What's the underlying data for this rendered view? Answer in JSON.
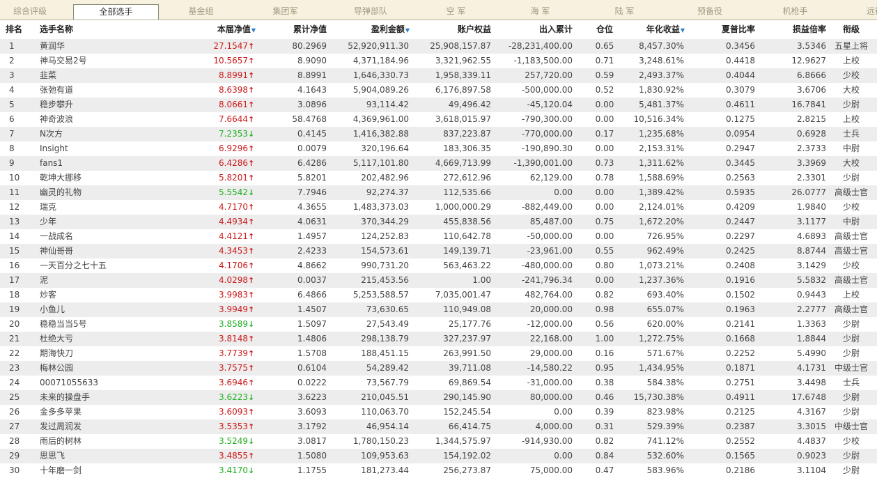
{
  "tabs": [
    {
      "label": "综合评级",
      "active": false
    },
    {
      "label": "全部选手",
      "active": true
    },
    {
      "label": "基金组",
      "active": false
    },
    {
      "label": "集团军",
      "active": false
    },
    {
      "label": "导弹部队",
      "active": false
    },
    {
      "label": "空  军",
      "active": false
    },
    {
      "label": "海  军",
      "active": false
    },
    {
      "label": "陆  军",
      "active": false
    },
    {
      "label": "预备役",
      "active": false
    },
    {
      "label": "机枪手",
      "active": false
    },
    {
      "label": "远征",
      "active": false
    }
  ],
  "columns": {
    "rank": "排名",
    "name": "选手名称",
    "nav": "本届净值",
    "cum_nav": "累计净值",
    "profit": "盈利金额",
    "equity": "账户权益",
    "flow": "出入累计",
    "position": "仓位",
    "annual": "年化收益",
    "sharpe": "夏普比率",
    "pl_ratio": "损益倍率",
    "title": "衔级"
  },
  "sort_icon": "triangle-down-icon",
  "colors": {
    "up": "#cc1a1a",
    "down": "#1fae1f",
    "sort": "#2a7fd0",
    "row_alt": "#ededed",
    "tabbar": "#f7f1df"
  },
  "rows": [
    {
      "rank": "1",
      "name": "黄润华",
      "nav": "27.1547",
      "trend": "up",
      "cum_nav": "80.2969",
      "profit": "52,920,911.30",
      "equity": "25,908,157.87",
      "flow": "-28,231,400.00",
      "position": "0.65",
      "annual": "8,457.30%",
      "sharpe": "0.3456",
      "pl_ratio": "3.5346",
      "title": "五星上将"
    },
    {
      "rank": "2",
      "name": "神马交易2号",
      "nav": "10.5657",
      "trend": "up",
      "cum_nav": "8.9090",
      "profit": "4,371,184.96",
      "equity": "3,321,962.55",
      "flow": "-1,183,500.00",
      "position": "0.71",
      "annual": "3,248.61%",
      "sharpe": "0.4418",
      "pl_ratio": "12.9627",
      "title": "上校"
    },
    {
      "rank": "3",
      "name": "韭菜",
      "nav": "8.8991",
      "trend": "up",
      "cum_nav": "8.8991",
      "profit": "1,646,330.73",
      "equity": "1,958,339.11",
      "flow": "257,720.00",
      "position": "0.59",
      "annual": "2,493.37%",
      "sharpe": "0.4044",
      "pl_ratio": "6.8666",
      "title": "少校"
    },
    {
      "rank": "4",
      "name": "张弛有道",
      "nav": "8.6398",
      "trend": "up",
      "cum_nav": "4.1643",
      "profit": "5,904,089.26",
      "equity": "6,176,897.58",
      "flow": "-500,000.00",
      "position": "0.52",
      "annual": "1,830.92%",
      "sharpe": "0.3079",
      "pl_ratio": "3.6706",
      "title": "大校"
    },
    {
      "rank": "5",
      "name": "稳步攀升",
      "nav": "8.0661",
      "trend": "up",
      "cum_nav": "3.0896",
      "profit": "93,114.42",
      "equity": "49,496.42",
      "flow": "-45,120.04",
      "position": "0.00",
      "annual": "5,481.37%",
      "sharpe": "0.4611",
      "pl_ratio": "16.7841",
      "title": "少尉"
    },
    {
      "rank": "6",
      "name": "神奇波浪",
      "nav": "7.6644",
      "trend": "up",
      "cum_nav": "58.4768",
      "profit": "4,369,961.00",
      "equity": "3,618,015.97",
      "flow": "-790,300.00",
      "position": "0.00",
      "annual": "10,516.34%",
      "sharpe": "0.1275",
      "pl_ratio": "2.8215",
      "title": "上校"
    },
    {
      "rank": "7",
      "name": "N次方",
      "nav": "7.2353",
      "trend": "down",
      "cum_nav": "0.4145",
      "profit": "1,416,382.88",
      "equity": "837,223.87",
      "flow": "-770,000.00",
      "position": "0.17",
      "annual": "1,235.68%",
      "sharpe": "0.0954",
      "pl_ratio": "0.6928",
      "title": "士兵"
    },
    {
      "rank": "8",
      "name": "Insight",
      "nav": "6.9296",
      "trend": "up",
      "cum_nav": "0.0079",
      "profit": "320,196.64",
      "equity": "183,306.35",
      "flow": "-190,890.30",
      "position": "0.00",
      "annual": "2,153.31%",
      "sharpe": "0.2947",
      "pl_ratio": "2.3733",
      "title": "中尉"
    },
    {
      "rank": "9",
      "name": "fans1",
      "nav": "6.4286",
      "trend": "up",
      "cum_nav": "6.4286",
      "profit": "5,117,101.80",
      "equity": "4,669,713.99",
      "flow": "-1,390,001.00",
      "position": "0.73",
      "annual": "1,311.62%",
      "sharpe": "0.3445",
      "pl_ratio": "3.3969",
      "title": "大校"
    },
    {
      "rank": "10",
      "name": "乾坤大挪移",
      "nav": "5.8201",
      "trend": "up",
      "cum_nav": "5.8201",
      "profit": "202,482.96",
      "equity": "272,612.96",
      "flow": "62,129.00",
      "position": "0.78",
      "annual": "1,588.69%",
      "sharpe": "0.2563",
      "pl_ratio": "2.3301",
      "title": "少尉"
    },
    {
      "rank": "11",
      "name": "幽灵的礼物",
      "nav": "5.5542",
      "trend": "down",
      "cum_nav": "7.7946",
      "profit": "92,274.37",
      "equity": "112,535.66",
      "flow": "0.00",
      "position": "0.00",
      "annual": "1,389.42%",
      "sharpe": "0.5935",
      "pl_ratio": "26.0777",
      "title": "高级士官"
    },
    {
      "rank": "12",
      "name": "瑞克",
      "nav": "4.7170",
      "trend": "up",
      "cum_nav": "4.3655",
      "profit": "1,483,373.03",
      "equity": "1,000,000.29",
      "flow": "-882,449.00",
      "position": "0.00",
      "annual": "2,124.01%",
      "sharpe": "0.4209",
      "pl_ratio": "1.9840",
      "title": "少校"
    },
    {
      "rank": "13",
      "name": "少年",
      "nav": "4.4934",
      "trend": "up",
      "cum_nav": "4.0631",
      "profit": "370,344.29",
      "equity": "455,838.56",
      "flow": "85,487.00",
      "position": "0.75",
      "annual": "1,672.20%",
      "sharpe": "0.2447",
      "pl_ratio": "3.1177",
      "title": "中尉"
    },
    {
      "rank": "14",
      "name": "一战成名",
      "nav": "4.4121",
      "trend": "up",
      "cum_nav": "1.4957",
      "profit": "124,252.83",
      "equity": "110,642.78",
      "flow": "-50,000.00",
      "position": "0.00",
      "annual": "726.95%",
      "sharpe": "0.2297",
      "pl_ratio": "4.6893",
      "title": "高级士官"
    },
    {
      "rank": "15",
      "name": "神仙哥哥",
      "nav": "4.3453",
      "trend": "up",
      "cum_nav": "2.4233",
      "profit": "154,573.61",
      "equity": "149,139.71",
      "flow": "-23,961.00",
      "position": "0.55",
      "annual": "962.49%",
      "sharpe": "0.2425",
      "pl_ratio": "8.8744",
      "title": "高级士官"
    },
    {
      "rank": "16",
      "name": "一天百分之七十五",
      "nav": "4.1706",
      "trend": "up",
      "cum_nav": "4.8662",
      "profit": "990,731.20",
      "equity": "563,463.22",
      "flow": "-480,000.00",
      "position": "0.80",
      "annual": "1,073.21%",
      "sharpe": "0.2408",
      "pl_ratio": "3.1429",
      "title": "少校"
    },
    {
      "rank": "17",
      "name": "泥",
      "nav": "4.0298",
      "trend": "up",
      "cum_nav": "0.0037",
      "profit": "215,453.56",
      "equity": "1.00",
      "flow": "-241,796.34",
      "position": "0.00",
      "annual": "1,237.36%",
      "sharpe": "0.1916",
      "pl_ratio": "5.5832",
      "title": "高级士官"
    },
    {
      "rank": "18",
      "name": "炒客",
      "nav": "3.9983",
      "trend": "up",
      "cum_nav": "6.4866",
      "profit": "5,253,588.57",
      "equity": "7,035,001.47",
      "flow": "482,764.00",
      "position": "0.82",
      "annual": "693.40%",
      "sharpe": "0.1502",
      "pl_ratio": "0.9443",
      "title": "上校"
    },
    {
      "rank": "19",
      "name": "小鱼儿",
      "nav": "3.9949",
      "trend": "up",
      "cum_nav": "1.4507",
      "profit": "73,630.65",
      "equity": "110,949.08",
      "flow": "20,000.00",
      "position": "0.98",
      "annual": "655.07%",
      "sharpe": "0.1963",
      "pl_ratio": "2.2777",
      "title": "高级士官"
    },
    {
      "rank": "20",
      "name": "稳稳当当5号",
      "nav": "3.8589",
      "trend": "down",
      "cum_nav": "1.5097",
      "profit": "27,543.49",
      "equity": "25,177.76",
      "flow": "-12,000.00",
      "position": "0.56",
      "annual": "620.00%",
      "sharpe": "0.2141",
      "pl_ratio": "1.3363",
      "title": "少尉"
    },
    {
      "rank": "21",
      "name": "杜绝大亏",
      "nav": "3.8148",
      "trend": "up",
      "cum_nav": "1.4806",
      "profit": "298,138.79",
      "equity": "327,237.97",
      "flow": "22,168.00",
      "position": "1.00",
      "annual": "1,272.75%",
      "sharpe": "0.1668",
      "pl_ratio": "1.8844",
      "title": "少尉"
    },
    {
      "rank": "22",
      "name": "期海快刀",
      "nav": "3.7739",
      "trend": "up",
      "cum_nav": "1.5708",
      "profit": "188,451.15",
      "equity": "263,991.50",
      "flow": "29,000.00",
      "position": "0.16",
      "annual": "571.67%",
      "sharpe": "0.2252",
      "pl_ratio": "5.4990",
      "title": "少尉"
    },
    {
      "rank": "23",
      "name": "梅林公园",
      "nav": "3.7575",
      "trend": "up",
      "cum_nav": "0.6104",
      "profit": "54,289.42",
      "equity": "39,711.08",
      "flow": "-14,580.22",
      "position": "0.95",
      "annual": "1,434.95%",
      "sharpe": "0.1871",
      "pl_ratio": "4.1731",
      "title": "中级士官"
    },
    {
      "rank": "24",
      "name": "00071055633",
      "nav": "3.6946",
      "trend": "up",
      "cum_nav": "0.0222",
      "profit": "73,567.79",
      "equity": "69,869.54",
      "flow": "-31,000.00",
      "position": "0.38",
      "annual": "584.38%",
      "sharpe": "0.2751",
      "pl_ratio": "3.4498",
      "title": "士兵"
    },
    {
      "rank": "25",
      "name": "未来的操盘手",
      "nav": "3.6223",
      "trend": "down",
      "cum_nav": "3.6223",
      "profit": "210,045.51",
      "equity": "290,145.90",
      "flow": "80,000.00",
      "position": "0.46",
      "annual": "15,730.38%",
      "sharpe": "0.4911",
      "pl_ratio": "17.6748",
      "title": "少尉"
    },
    {
      "rank": "26",
      "name": "金多多苹果",
      "nav": "3.6093",
      "trend": "up",
      "cum_nav": "3.6093",
      "profit": "110,063.70",
      "equity": "152,245.54",
      "flow": "0.00",
      "position": "0.39",
      "annual": "823.98%",
      "sharpe": "0.2125",
      "pl_ratio": "4.3167",
      "title": "少尉"
    },
    {
      "rank": "27",
      "name": "发过周润发",
      "nav": "3.5353",
      "trend": "up",
      "cum_nav": "3.1792",
      "profit": "46,954.14",
      "equity": "66,414.75",
      "flow": "4,000.00",
      "position": "0.31",
      "annual": "529.39%",
      "sharpe": "0.2387",
      "pl_ratio": "3.3015",
      "title": "中级士官"
    },
    {
      "rank": "28",
      "name": "雨后的树林",
      "nav": "3.5249",
      "trend": "down",
      "cum_nav": "3.0817",
      "profit": "1,780,150.23",
      "equity": "1,344,575.97",
      "flow": "-914,930.00",
      "position": "0.82",
      "annual": "741.12%",
      "sharpe": "0.2552",
      "pl_ratio": "4.4837",
      "title": "少校"
    },
    {
      "rank": "29",
      "name": "思思飞",
      "nav": "3.4855",
      "trend": "up",
      "cum_nav": "1.5080",
      "profit": "109,953.63",
      "equity": "154,192.02",
      "flow": "0.00",
      "position": "0.84",
      "annual": "532.60%",
      "sharpe": "0.1565",
      "pl_ratio": "0.9023",
      "title": "少尉"
    },
    {
      "rank": "30",
      "name": "十年磨一剑",
      "nav": "3.4170",
      "trend": "down",
      "cum_nav": "1.1755",
      "profit": "181,273.44",
      "equity": "256,273.87",
      "flow": "75,000.00",
      "position": "0.47",
      "annual": "583.96%",
      "sharpe": "0.2186",
      "pl_ratio": "3.1104",
      "title": "少尉"
    }
  ]
}
